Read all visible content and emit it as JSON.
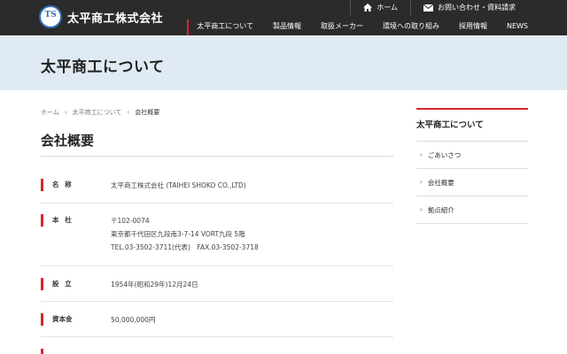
{
  "header": {
    "logo_mark": "TS",
    "logo_text": "太平商工株式会社",
    "util": [
      {
        "label": "ホーム",
        "icon": "home-icon"
      },
      {
        "label": "お問い合わせ・資料請求",
        "icon": "mail-icon"
      }
    ],
    "nav": [
      {
        "label": "太平商工について"
      },
      {
        "label": "製品情報"
      },
      {
        "label": "取扱メーカー"
      },
      {
        "label": "環境への取り組み"
      },
      {
        "label": "採用情報"
      },
      {
        "label": "NEWS"
      }
    ]
  },
  "hero": {
    "title": "太平商工について"
  },
  "breadcrumb": {
    "home": "ホーム",
    "parent": "太平商工について",
    "current": "会社概要"
  },
  "main": {
    "title": "会社概要",
    "rows": [
      {
        "label": "名 称",
        "lines": [
          "太平商工株式会社 (TAIHEI SHOKO CO.,LTD)"
        ]
      },
      {
        "label": "本 社",
        "lines": [
          "〒102-0074",
          "東京都千代田区九段南3-7-14 VORT九段 5階",
          "TEL.03-3502-3711(代表)　FAX.03-3502-3718"
        ]
      },
      {
        "label": "設 立",
        "lines": [
          "1954年(昭和29年)12月24日"
        ]
      },
      {
        "label": "資本金",
        "lines": [
          "50,000,000円"
        ]
      }
    ]
  },
  "sidebar": {
    "title": "太平商工について",
    "items": [
      {
        "label": "ごあいさつ"
      },
      {
        "label": "会社概要"
      },
      {
        "label": "拠点紹介"
      }
    ]
  },
  "colors": {
    "accent": "#d6262f",
    "header_bg": "#2b2b2b",
    "hero_bg": "#dfeaf4",
    "logo_blue": "#2f6db5"
  }
}
